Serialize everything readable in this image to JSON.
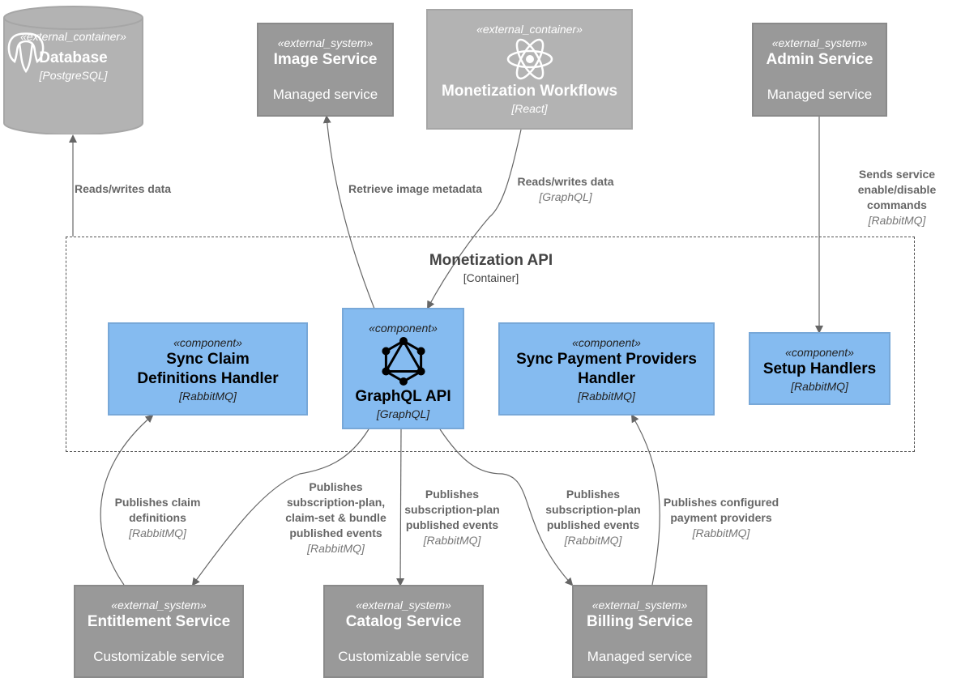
{
  "boundary": {
    "title": "Monetization API",
    "type": "[Container]"
  },
  "nodes": {
    "database": {
      "stereotype": "«external_container»",
      "title": "Database",
      "tech": "[PostgreSQL]",
      "icon": "postgresql-elephant-icon"
    },
    "image_service": {
      "stereotype": "«external_system»",
      "title": "Image Service",
      "desc": "Managed service"
    },
    "monetization_workflows": {
      "stereotype": "«external_container»",
      "title": "Monetization Workflows",
      "tech": "[React]",
      "icon": "react-atom-icon"
    },
    "admin_service": {
      "stereotype": "«external_system»",
      "title": "Admin Service",
      "desc": "Managed service"
    },
    "sync_claim": {
      "stereotype": "«component»",
      "title": "Sync Claim Definitions Handler",
      "tech": "[RabbitMQ]"
    },
    "graphql_api": {
      "stereotype": "«component»",
      "title": "GraphQL API",
      "tech": "[GraphQL]",
      "icon": "graphql-icon"
    },
    "sync_payment": {
      "stereotype": "«component»",
      "title": "Sync Payment Providers Handler",
      "tech": "[RabbitMQ]"
    },
    "setup_handlers": {
      "stereotype": "«component»",
      "title": "Setup Handlers",
      "tech": "[RabbitMQ]"
    },
    "entitlement_service": {
      "stereotype": "«external_system»",
      "title": "Entitlement Service",
      "desc": "Customizable service"
    },
    "catalog_service": {
      "stereotype": "«external_system»",
      "title": "Catalog Service",
      "desc": "Customizable service"
    },
    "billing_service": {
      "stereotype": "«external_system»",
      "title": "Billing Service",
      "desc": "Managed service"
    }
  },
  "edges": [
    {
      "id": "api-to-db",
      "label": "Reads/writes data",
      "tech": ""
    },
    {
      "id": "graphql-to-image",
      "label": "Retrieve image metadata",
      "tech": ""
    },
    {
      "id": "workflows-to-graphql",
      "label": "Reads/writes data",
      "tech": "[GraphQL]"
    },
    {
      "id": "admin-to-setup",
      "label": "Sends service enable/disable commands",
      "tech": "[RabbitMQ]"
    },
    {
      "id": "entitlement-to-syncclaim",
      "label": "Publishes claim definitions",
      "tech": "[RabbitMQ]"
    },
    {
      "id": "graphql-to-entitlement",
      "label": "Publishes subscription-plan, claim-set & bundle published events",
      "tech": "[RabbitMQ]"
    },
    {
      "id": "graphql-to-catalog",
      "label": "Publishes subscription-plan published events",
      "tech": "[RabbitMQ]"
    },
    {
      "id": "graphql-to-billing",
      "label": "Publishes subscription-plan published events",
      "tech": "[RabbitMQ]"
    },
    {
      "id": "billing-to-syncpayment",
      "label": "Publishes configured payment providers",
      "tech": "[RabbitMQ]"
    }
  ],
  "colors": {
    "component": "#85bbf0",
    "external_system": "#999999",
    "external_container": "#b3b3b3",
    "edge": "#666666"
  }
}
